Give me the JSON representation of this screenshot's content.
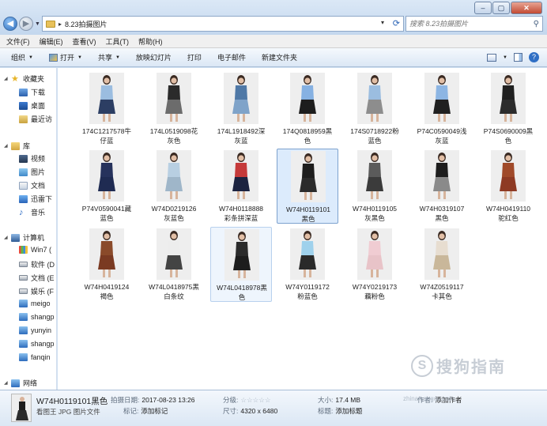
{
  "window": {
    "path": "8.23拍摄图片",
    "search_placeholder": "搜索 8.23拍摄图片",
    "controls": {
      "minimize": "–",
      "maximize": "▢",
      "close": "✕"
    }
  },
  "menu": [
    "文件(F)",
    "编辑(E)",
    "查看(V)",
    "工具(T)",
    "帮助(H)"
  ],
  "toolbar": {
    "organize": "组织",
    "open": "打开",
    "share": "共享",
    "slideshow": "放映幻灯片",
    "print": "打印",
    "email": "电子邮件",
    "new_folder": "新建文件夹"
  },
  "sidebar": {
    "favorites": "收藏夹",
    "fav_items": [
      "下载",
      "桌面",
      "最近访"
    ],
    "libraries": "库",
    "lib_items": [
      "视频",
      "图片",
      "文档",
      "迅雷下",
      "音乐"
    ],
    "computer": "计算机",
    "computer_items": [
      "Win7 (",
      "软件 (D",
      "文档 (E",
      "娱乐 (F",
      "meigo",
      "shangp",
      "yunyin",
      "shangp",
      "fanqin"
    ],
    "network": "网络"
  },
  "files": [
    {
      "line1": "174C1217578牛",
      "line2": "仔蓝",
      "color": "#2c3e63",
      "top": "#9bbde0"
    },
    {
      "line1": "174L0519098花",
      "line2": "灰色",
      "color": "#6c6c6c",
      "top": "#2b2b2b"
    },
    {
      "line1": "174L1918492深",
      "line2": "灰蓝",
      "color": "#7fa3c9",
      "top": "#4f78a6"
    },
    {
      "line1": "174Q0818959黑",
      "line2": "色",
      "color": "#1d1d1d",
      "top": "#86b1e2"
    },
    {
      "line1": "174S0718922粉",
      "line2": "蓝色",
      "color": "#8d8d8d",
      "top": "#9bbde0"
    },
    {
      "line1": "P74C0590049浅",
      "line2": "灰蓝",
      "color": "#202020",
      "top": "#8cb5e3"
    },
    {
      "line1": "P74S0690009黑",
      "line2": "色",
      "color": "#2c2c2c",
      "top": "#202020"
    },
    {
      "line1": "P74V0590041藏",
      "line2": "蓝色",
      "color": "#1f2b52",
      "top": "#26325c"
    },
    {
      "line1": "W74D0219126",
      "line2": "灰蓝色",
      "color": "#9fb6c9",
      "top": "#b8cfe2"
    },
    {
      "line1": "W74H0118888",
      "line2": "彩条拼深蓝",
      "color": "#1c2340",
      "top": "#c53a3a"
    },
    {
      "line1": "W74H0119101",
      "line2": "黑色",
      "color": "#2b2b2b",
      "top": "#1d1d1d"
    },
    {
      "line1": "W74H0119105",
      "line2": "灰黑色",
      "color": "#3b3b3b",
      "top": "#5b5b5b"
    },
    {
      "line1": "W74H0319107",
      "line2": "黑色",
      "color": "#8a8a8a",
      "top": "#1d1d1d"
    },
    {
      "line1": "W74H0419110",
      "line2": "驼红色",
      "color": "#8e3a24",
      "top": "#a04a2a"
    },
    {
      "line1": "W74H0419124",
      "line2": "褐色",
      "color": "#7a3a22",
      "top": "#8a4a2a"
    },
    {
      "line1": "W74L0418975黑",
      "line2": "白条纹",
      "color": "#444444",
      "top": "#ededed"
    },
    {
      "line1": "W74L0418978黑",
      "line2": "色",
      "color": "#1d1d1d",
      "top": "#2b2b2b"
    },
    {
      "line1": "W74Y0119172",
      "line2": "粉蓝色",
      "color": "#2a2a2a",
      "top": "#9fd1ec"
    },
    {
      "line1": "W74Y0219173",
      "line2": "藕粉色",
      "color": "#e8c3c8",
      "top": "#f0ccd2"
    },
    {
      "line1": "W74Z0519117",
      "line2": "卡其色",
      "color": "#c9b79a",
      "top": "#e7ddd0"
    }
  ],
  "details": {
    "filename": "W74H0119101黑色",
    "type": "看图王 JPG 图片文件",
    "date_label": "拍摄日期:",
    "date_value": "2017-08-23 13:26",
    "tags_label": "标记:",
    "tags_value": "添加标记",
    "rating_label": "分级:",
    "rating_value": "☆☆☆☆☆",
    "dims_label": "尺寸:",
    "dims_value": "4320 x 6480",
    "size_label": "大小:",
    "size_value": "17.4 MB",
    "title_label": "标题:",
    "title_value": "添加标题",
    "author_label": "作者:",
    "author_value": "添加作者"
  },
  "watermark": {
    "logo": "S",
    "text": "搜狗指南",
    "url": "zhinan.sogou.com"
  }
}
